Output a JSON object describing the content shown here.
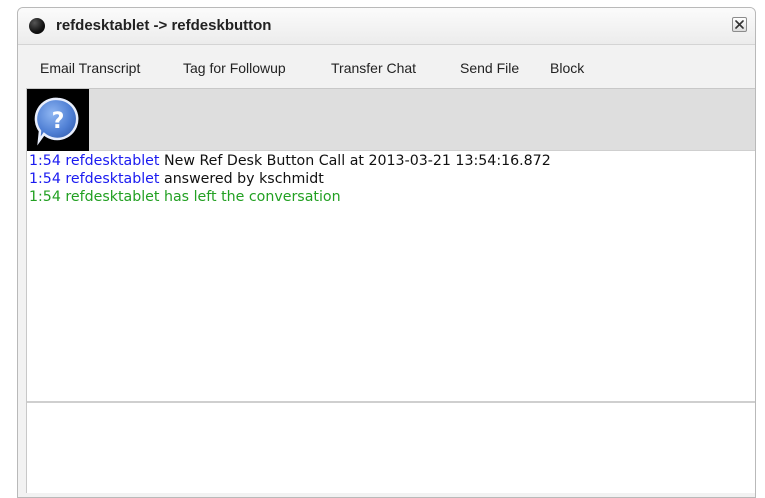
{
  "window": {
    "title": "refdesktablet -> refdeskbutton",
    "close_label": "×"
  },
  "toolbar": {
    "items": [
      {
        "label": "Email Transcript"
      },
      {
        "label": "Tag for Followup"
      },
      {
        "label": "Transfer Chat"
      },
      {
        "label": "Send File"
      },
      {
        "label": "Block"
      }
    ]
  },
  "avatar": {
    "icon": "question-bubble-icon",
    "glyph": "?"
  },
  "transcript": {
    "lines": [
      {
        "time": "1:54",
        "user": "refdesktablet",
        "text": "New Ref Desk Button Call at 2013-03-21 13:54:16.872",
        "style": "message"
      },
      {
        "time": "1:54",
        "user": "refdesktablet",
        "text": "answered by kschmidt",
        "style": "message"
      },
      {
        "time": "1:54",
        "user": "refdesktablet",
        "text": "has left the conversation",
        "style": "system"
      }
    ]
  },
  "compose": {
    "value": ""
  },
  "colors": {
    "username": "#1a1af0",
    "system": "#22a022",
    "avatar_bg": "#000000",
    "avatar_bubble": "#5a8fe0"
  }
}
